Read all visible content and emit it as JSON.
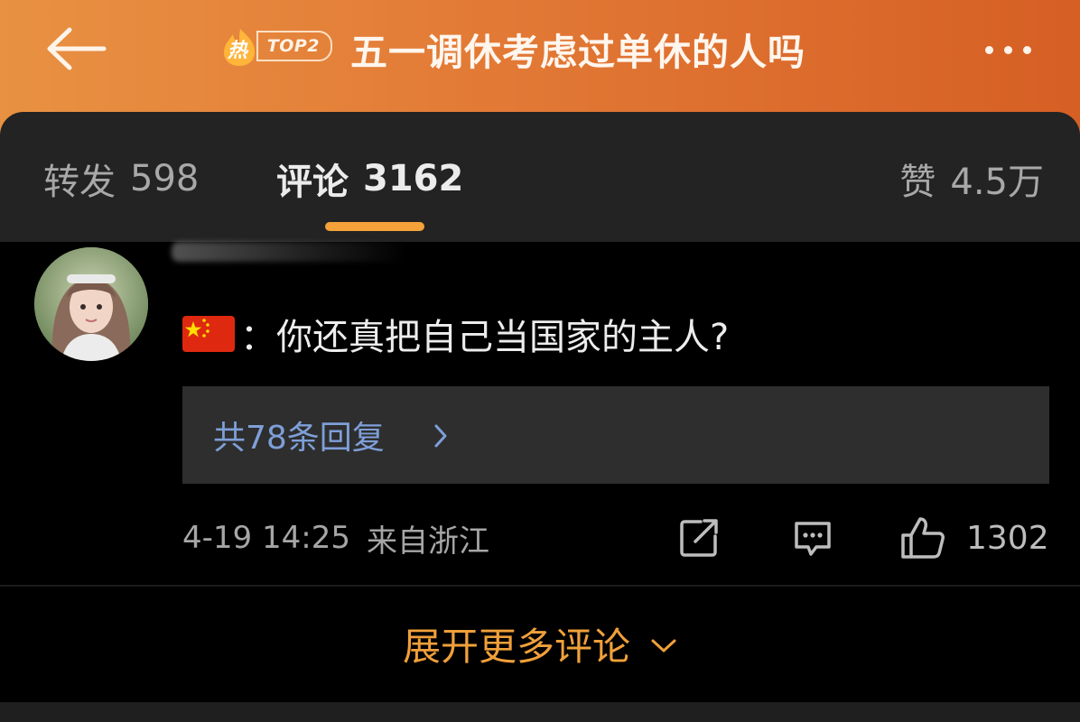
{
  "header": {
    "hot_badge": {
      "flame_char": "热",
      "rank_label": "TOP2"
    },
    "title": "五一调休考虑过单休的人吗",
    "icons": {
      "back": "back-arrow-icon",
      "more": "more-dots-icon",
      "badge": "flame-icon"
    }
  },
  "tabs": {
    "repost": {
      "label": "转发",
      "count": "598"
    },
    "comment": {
      "label": "评论",
      "count": "3162"
    },
    "like": {
      "label": "赞",
      "count": "4.5万"
    },
    "active": "comment",
    "accent_color": "#f5a23a"
  },
  "comment": {
    "flag_emoji": "🇨🇳",
    "text": "：你还真把自己当国家的主人?",
    "replies_label": "共78条回复",
    "timestamp": "4-19 14:25",
    "location": "来自浙江",
    "like_count": "1302",
    "icons": {
      "share": "share-icon",
      "reply": "comment-icon",
      "like": "thumbs-up-icon",
      "replies": "chevron-right-icon"
    }
  },
  "footer": {
    "expand_label": "展开更多评论",
    "expand_icon": "chevron-down-icon"
  }
}
